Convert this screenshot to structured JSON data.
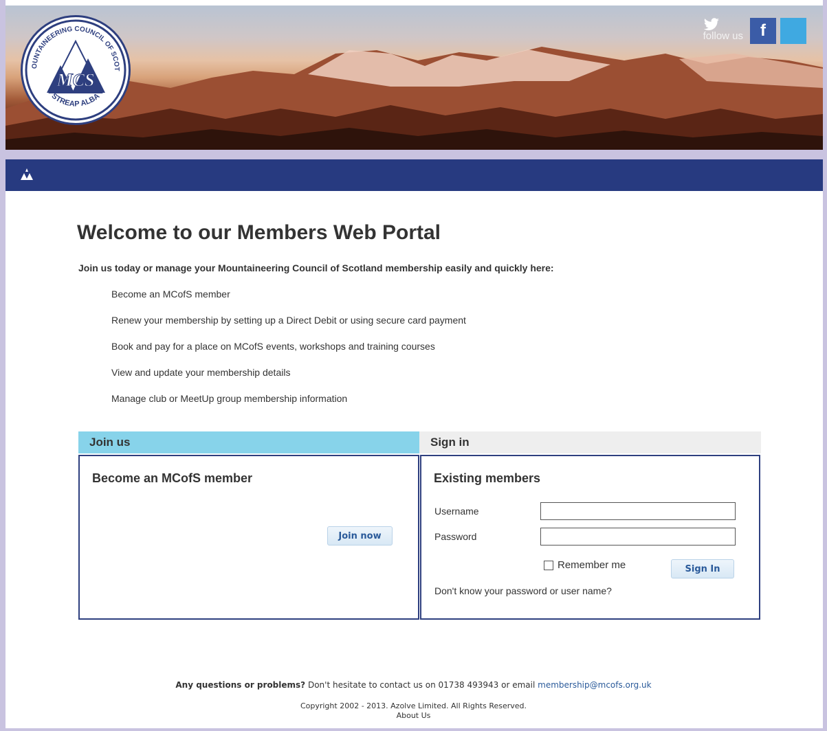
{
  "header": {
    "logo": {
      "top_text": "THE MOUNTAINEERING COUNCIL OF SCOTLAND",
      "initials": "MCS",
      "bottom_text": "STREAP ALBA"
    },
    "follow_text": "follow us",
    "social": [
      {
        "name": "facebook",
        "glyph": "f"
      },
      {
        "name": "twitter",
        "glyph": "t"
      }
    ]
  },
  "nav": {
    "icon": "mountain-logo-icon"
  },
  "main": {
    "title": "Welcome to our Members Web Portal",
    "intro": "Join us today or manage your Mountaineering Council of Scotland membership easily and quickly here:",
    "bullets": [
      "Become an MCofS member",
      "Renew your membership by setting up a Direct Debit or using secure card payment",
      "Book and pay for a place on MCofS events, workshops and training courses",
      "View and update your membership details",
      "Manage club or MeetUp group membership information"
    ]
  },
  "join": {
    "tab_label": "Join us",
    "title": "Become an MCofS member",
    "button": "Join now"
  },
  "signin": {
    "tab_label": "Sign in",
    "title": "Existing members",
    "username_label": "Username",
    "username_value": "",
    "password_label": "Password",
    "password_value": "",
    "remember_label": "Remember me",
    "remember_checked": false,
    "button": "Sign In",
    "forgot": "Don't know your password or user name?"
  },
  "footer": {
    "question_bold": "Any questions or problems?",
    "question_text": " Don't hesitate to contact us on 01738 493943 or email ",
    "email": "membership@mcofs.org.uk",
    "copyright": "Copyright 2002 - 2013. Azolve Limited. All Rights Reserved.",
    "about": "About Us"
  },
  "colors": {
    "navbar": "#273a80",
    "join_tab": "#87d3ea",
    "sign_tab": "#eeeeee",
    "page_border": "#c9c3e0",
    "link": "#2a5a9a"
  }
}
